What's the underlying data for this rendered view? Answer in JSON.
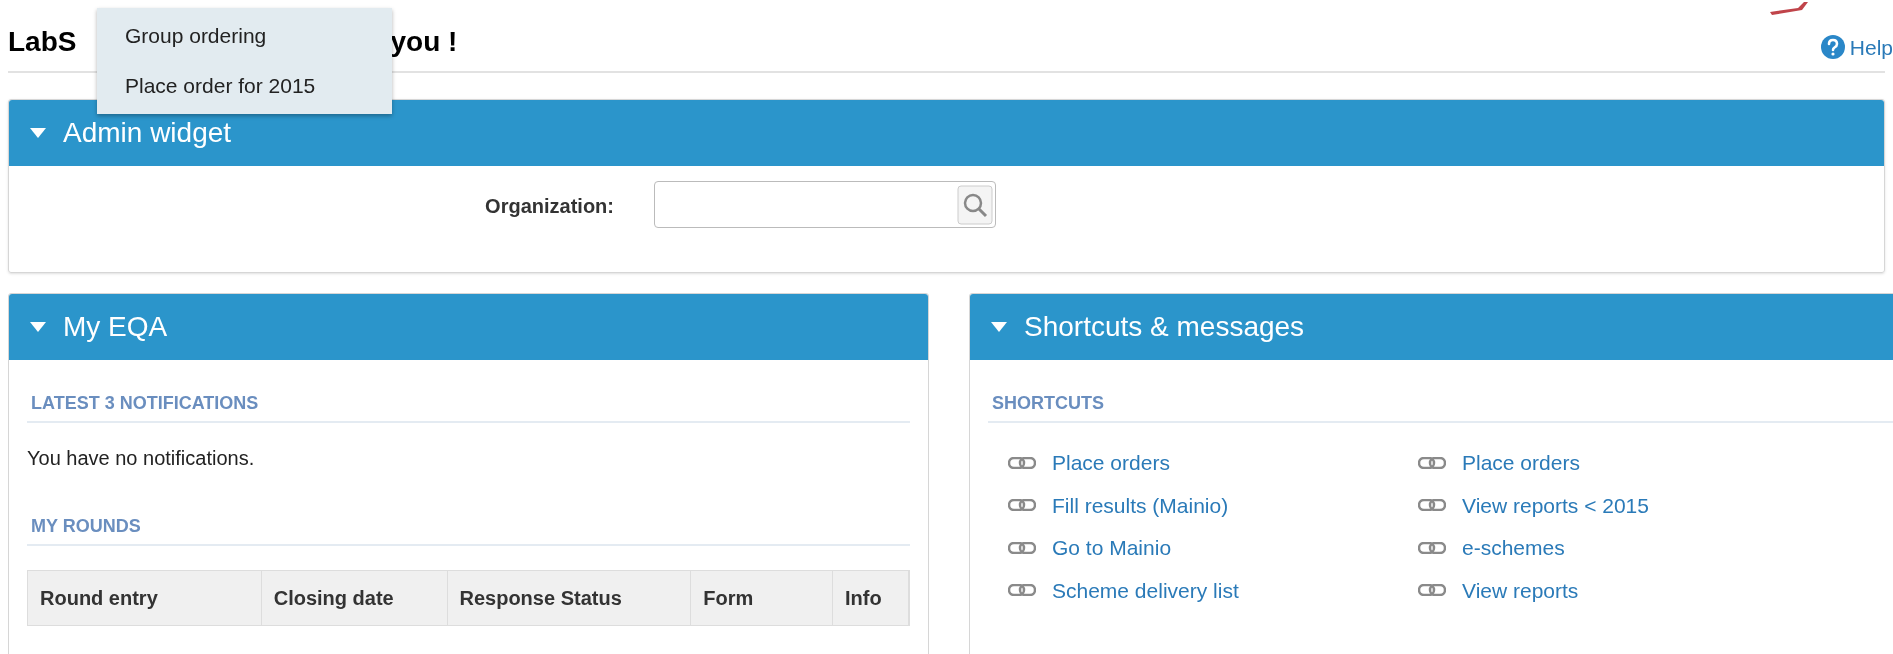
{
  "page_title": {
    "start": "LabS",
    "end": "you !"
  },
  "menu": {
    "items": [
      {
        "label": "Group ordering"
      },
      {
        "label": "Place order for 2015"
      }
    ]
  },
  "help": {
    "label": "Help"
  },
  "admin_widget": {
    "title": "Admin widget",
    "expanded": true,
    "organization": {
      "label": "Organization:"
    }
  },
  "my_eqa": {
    "title": "My EQA",
    "expanded": true,
    "notifications_heading": "LATEST 3 NOTIFICATIONS",
    "notifications_text": "You have no notifications.",
    "rounds_heading": "MY ROUNDS",
    "table": {
      "columns": [
        "Round entry",
        "Closing date",
        "Response Status",
        "Form",
        "Info"
      ]
    }
  },
  "shortcuts_panel": {
    "title": "Shortcuts & messages",
    "expanded": true,
    "heading": "SHORTCUTS",
    "columns": [
      [
        "Place orders",
        "Fill results (Mainio)",
        "Go to Mainio",
        "Scheme delivery list"
      ],
      [
        "Place orders",
        "View reports < 2015",
        "e-schemes",
        "View reports"
      ]
    ]
  }
}
